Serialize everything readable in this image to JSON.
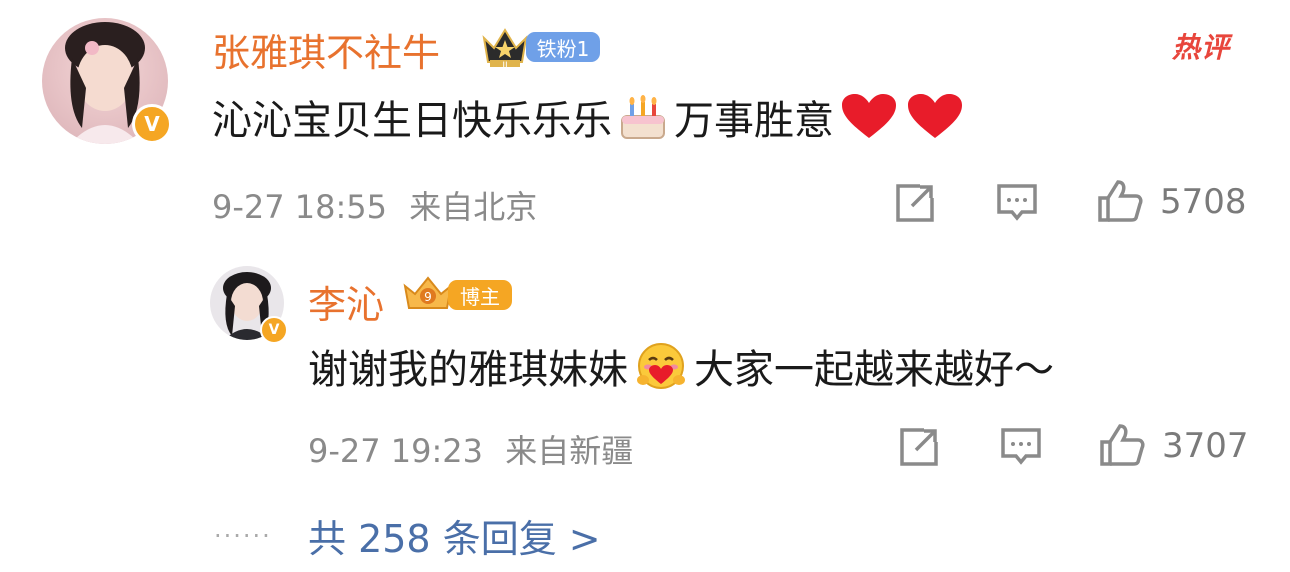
{
  "comment": {
    "username": "张雅琪不社牛",
    "fan_badge": "铁粉1",
    "hot_label": "热评",
    "text_part1": "沁沁宝贝生日快乐乐乐",
    "text_part2": "万事胜意",
    "date": "9-27 18:55",
    "location": "来自北京",
    "like_count": "5708"
  },
  "reply": {
    "username": "李沁",
    "role_badge": "博主",
    "text_part1": "谢谢我的雅琪妹妹",
    "text_part2": "大家一起越来越好～",
    "date": "9-27 19:23",
    "location": "来自新疆",
    "like_count": "3707"
  },
  "more_replies": {
    "dots": "......",
    "label": "共 258 条回复 >"
  },
  "colors": {
    "username": "#e8722e",
    "hot": "#e8463c",
    "link": "#4a6fa8",
    "meta": "#8a8a8a",
    "badge_blue": "#6fa0e8",
    "badge_orange": "#f5a623"
  }
}
